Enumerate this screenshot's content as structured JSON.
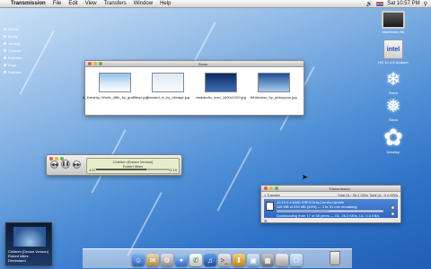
{
  "menubar": {
    "app_name": "Transmission",
    "menus": [
      "File",
      "Edit",
      "View",
      "Transfers",
      "Window",
      "Help"
    ],
    "clock": "Sat 10:57 PM"
  },
  "sidebar": {
    "items": [
      "Dexter",
      "family",
      "Jerking",
      "Trevess",
      "Rubbles",
      "Dogs",
      "Rubbles"
    ]
  },
  "desktop": {
    "icons": [
      {
        "label": "Macintosh HD",
        "icon": "hard-drive-icon"
      },
      {
        "label": "HG 10.4.8 Updater",
        "icon": "installer-icon"
      },
      {
        "label": "Snow",
        "icon": "snowflake-icon"
      },
      {
        "label": "Stock",
        "icon": "snowflake-icon"
      },
      {
        "label": "Desktop",
        "icon": "snowflake-icon"
      }
    ]
  },
  "finder": {
    "title": "Snow",
    "files": [
      {
        "name": "A_Dreamy_World_48th_by_graffiteye.jpg"
      },
      {
        "name": "Snowed_in_by_dimage.jpg"
      },
      {
        "name": "vladstudio_noel_1600x1200.jpg"
      },
      {
        "name": "Whiteness_by_pickuppoo.jpg"
      }
    ]
  },
  "itunes": {
    "song": "Children [Dream Version]",
    "artist": "Robert Miles",
    "elapsed": "4:57",
    "remaining": "-2:19",
    "progress": 0.68
  },
  "transmission": {
    "title": "Transmission",
    "count_label": "1 Transfer",
    "totals": "Total DL: 26.2 KB/s   Total UL: 0.0 KB/s",
    "torrent_name": "10.10.4.4.AMD.SSE3.Only.Combo.Update",
    "torrent_info": "115 MB of 230 MB (49%) — 1 hr 51 min remaining",
    "torrent_status": "Downloading from 17 of 38 peers — DL: 26.2 KB/s, UL: 0.0 KB/s",
    "progress": 0.49
  },
  "album": {
    "line1": "Children [Dream Version]",
    "line2": "Robert Miles",
    "line3": "Dreamland"
  },
  "colors": {
    "accent": "#2f66c2",
    "desktop": "#4f8fd6"
  }
}
